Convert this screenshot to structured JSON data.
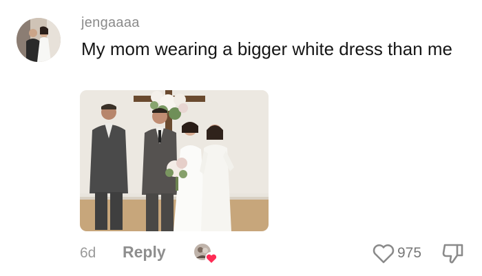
{
  "comment": {
    "username": "jengaaaa",
    "text": "My mom wearing a bigger white dress than me",
    "time": "6d",
    "reply_label": "Reply",
    "like_count": "975"
  },
  "colors": {
    "heart_accent": "#fe2c55",
    "text_primary": "#161616",
    "text_secondary": "#8a8a8a"
  },
  "icons": [
    "avatar-photo",
    "wedding-photo",
    "creator-liked-heart-icon",
    "heart-outline-icon",
    "thumbs-down-icon"
  ]
}
